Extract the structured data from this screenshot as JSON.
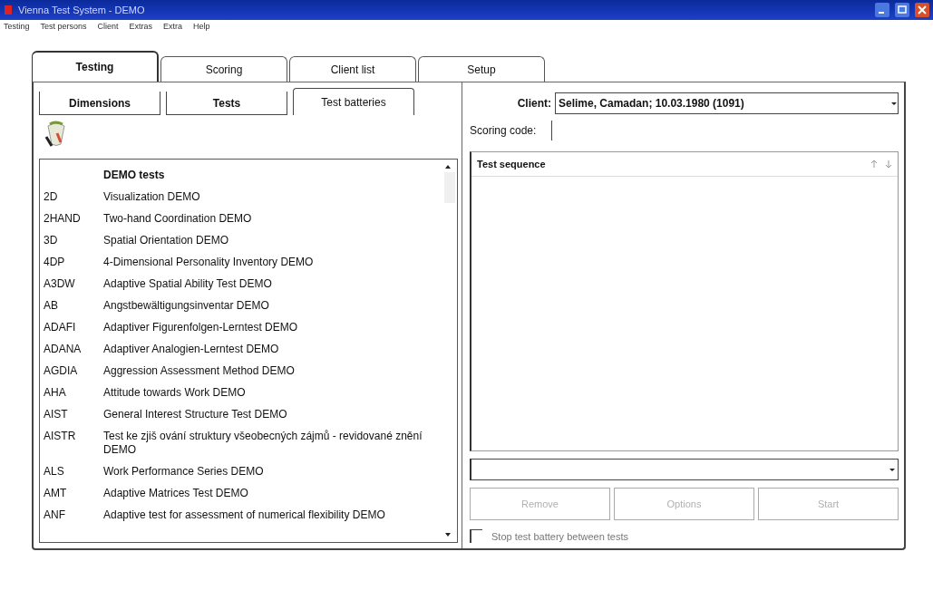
{
  "window": {
    "title": "Vienna Test System - DEMO"
  },
  "menu": [
    "Testing",
    "Test persons",
    "Client",
    "Extras",
    "Extra",
    "Help"
  ],
  "tabs": [
    {
      "label": "Testing",
      "selected": true
    },
    {
      "label": "Scoring",
      "selected": false
    },
    {
      "label": "Client list",
      "selected": false
    },
    {
      "label": "Setup",
      "selected": false
    }
  ],
  "subtabs": [
    {
      "label": "Dimensions",
      "selected": false
    },
    {
      "label": "Tests",
      "selected": false
    },
    {
      "label": "Test batteries",
      "selected": true
    }
  ],
  "test_list": {
    "group": "DEMO tests",
    "rows": [
      {
        "code": "2D",
        "name": "Visualization DEMO"
      },
      {
        "code": "2HAND",
        "name": "Two-hand Coordination DEMO"
      },
      {
        "code": "3D",
        "name": "Spatial Orientation DEMO"
      },
      {
        "code": "4DP",
        "name": "4-Dimensional Personality Inventory DEMO"
      },
      {
        "code": "A3DW",
        "name": "Adaptive Spatial Ability Test DEMO"
      },
      {
        "code": "AB",
        "name": "Angstbewältigungsinventar DEMO"
      },
      {
        "code": "ADAFI",
        "name": "Adaptiver Figurenfolgen-Lerntest DEMO"
      },
      {
        "code": "ADANA",
        "name": "Adaptiver Analogien-Lerntest DEMO"
      },
      {
        "code": "AGDIA",
        "name": "Aggression Assessment Method DEMO"
      },
      {
        "code": "AHA",
        "name": "Attitude towards Work DEMO"
      },
      {
        "code": "AIST",
        "name": "General Interest Structure Test DEMO"
      },
      {
        "code": "AISTR",
        "name": "Test ke zjiš ování struktury všeobecných zájmů - revidované znění DEMO"
      },
      {
        "code": "ALS",
        "name": "Work Performance Series DEMO"
      },
      {
        "code": "AMT",
        "name": "Adaptive Matrices Test DEMO"
      },
      {
        "code": "ANF",
        "name": "Adaptive test for assessment of numerical flexibility DEMO"
      }
    ]
  },
  "client": {
    "label": "Client:",
    "value": "Selime, Camadan; 10.03.1980 (1091)"
  },
  "scoring_code": {
    "label": "Scoring code:"
  },
  "test_sequence": {
    "title": "Test sequence"
  },
  "buttons": [
    {
      "label": "Remove",
      "disabled": true
    },
    {
      "label": "Options",
      "disabled": true
    },
    {
      "label": "Start",
      "disabled": true
    }
  ],
  "stop_checkbox": {
    "label": "Stop test battery between tests",
    "checked": false
  }
}
